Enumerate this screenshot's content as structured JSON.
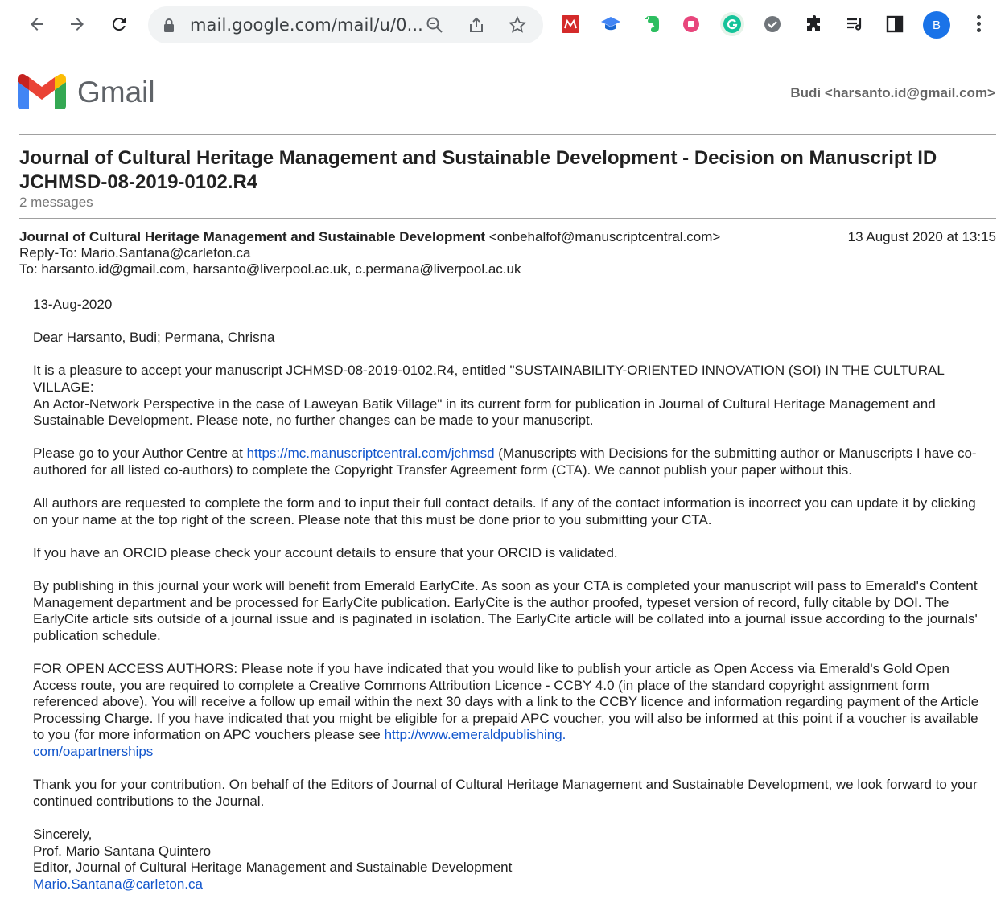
{
  "browser": {
    "url": "mail.google.com/mail/u/0...",
    "avatar_letter": "B"
  },
  "app": {
    "brand": "Gmail",
    "account": "Budi <harsanto.id@gmail.com>"
  },
  "thread": {
    "subject": "Journal of Cultural Heritage Management and Sustainable Development - Decision on Manuscript ID JCHMSD-08-2019-0102.R4",
    "count": "2 messages"
  },
  "message": {
    "sender_name": "Journal of Cultural Heritage Management and Sustainable Development",
    "sender_email": "<onbehalfof@manuscriptcentral.com>",
    "date": "13 August 2020 at 13:15",
    "reply_to": "Reply-To: Mario.Santana@carleton.ca",
    "to": "To: harsanto.id@gmail.com, harsanto@liverpool.ac.uk, c.permana@liverpool.ac.uk",
    "p_date": "13-Aug-2020",
    "p_greeting": "Dear Harsanto, Budi; Permana, Chrisna",
    "p_accept_1": "It is a pleasure to accept your manuscript JCHMSD-08-2019-0102.R4, entitled \"SUSTAINABILITY-ORIENTED INNOVATION (SOI) IN THE CULTURAL VILLAGE:",
    "p_accept_2": "An Actor-Network Perspective in the case of Laweyan Batik Village\" in its current form for publication in Journal of Cultural Heritage Management and Sustainable Development.   Please note, no further changes can be made to your manuscript.",
    "p_centre_pre": "Please go to your Author Centre at ",
    "p_centre_link": "https://mc.manuscriptcentral.com/jchmsd",
    "p_centre_post": " (Manuscripts with Decisions for the submitting author or Manuscripts I have co-authored for all listed co-authors) to complete the Copyright Transfer Agreement form (CTA).  We cannot publish your paper without this.",
    "p_authors": "All authors are requested to complete the form and to input their full contact details. If any of the contact information is incorrect you can update it by clicking on your name at the top right of the screen. Please note that this must be done prior to you submitting your CTA.",
    "p_orcid": "If you have an ORCID please check your account details to ensure that your ORCID is validated.",
    "p_earlycite": "By publishing in this journal your work will benefit from Emerald EarlyCite. As soon as your CTA is completed your manuscript will pass to Emerald's Content Management department and be processed for EarlyCite publication. EarlyCite is the author proofed, typeset version of record, fully citable by DOI. The EarlyCite article sits outside of a journal issue and is paginated in isolation. The EarlyCite article will be collated into a journal issue according to the journals' publication schedule.",
    "p_oa_pre": "FOR OPEN ACCESS AUTHORS: Please note if you have indicated that you would like to publish your article as Open Access via Emerald's Gold Open Access route, you are required to complete a Creative Commons Attribution Licence - CCBY 4.0 (in place of the standard copyright assignment form referenced above). You will receive a follow up email within the next 30 days with a link to the CCBY licence and information regarding payment of the Article Processing Charge. If you have indicated that you might be eligible for a prepaid APC voucher, you will also be informed at this point if a voucher is available to you (for more information on APC vouchers please see ",
    "p_oa_link_1": "http://www.emeraldpublishing.",
    "p_oa_link_2": "com/oapartnerships",
    "p_thanks": "Thank you for your contribution. On behalf of the Editors of Journal of Cultural Heritage Management and Sustainable Development, we look forward to your continued contributions to the Journal.",
    "sig_closing": "Sincerely,",
    "sig_name": "Prof. Mario Santana Quintero",
    "sig_title": "Editor, Journal of Cultural Heritage Management and Sustainable Development",
    "sig_email": "Mario.Santana@carleton.ca"
  },
  "colors": {
    "link": "#1155cc",
    "avatar": "#1a73e8"
  }
}
